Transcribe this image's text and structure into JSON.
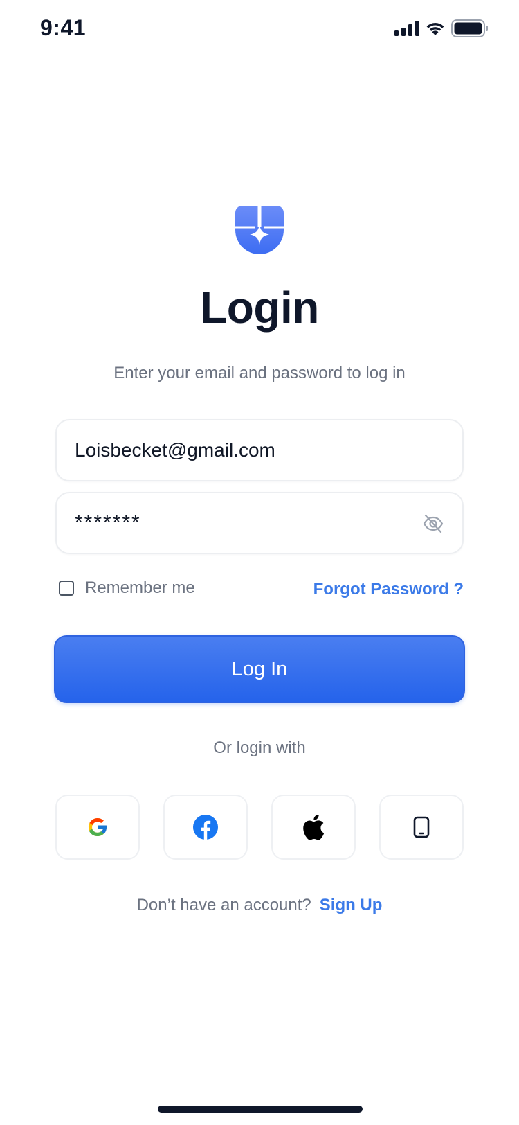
{
  "status_bar": {
    "time": "9:41",
    "icons": [
      "cellular-signal-icon",
      "wifi-icon",
      "battery-icon"
    ]
  },
  "logo": {
    "icon": "shield-sparkle-logo",
    "color": "#4f7cf5"
  },
  "header": {
    "title": "Login",
    "subtitle": "Enter your email and password to log in"
  },
  "form": {
    "email_value": "Loisbecket@gmail.com",
    "password_value": "*******",
    "password_toggle_icon": "eye-off-icon",
    "remember_label": "Remember me",
    "remember_checked": false,
    "forgot_label": "Forgot Password ?",
    "submit_label": "Log In"
  },
  "social": {
    "divider_label": "Or login with",
    "providers": [
      "google-icon",
      "facebook-icon",
      "apple-icon",
      "phone-icon"
    ]
  },
  "footer": {
    "prompt": "Don’t have an account?",
    "signup_label": "Sign Up"
  },
  "colors": {
    "accent": "#2563eb",
    "link": "#3b7ae8",
    "text_primary": "#0f172a",
    "text_secondary": "#6b7280"
  }
}
